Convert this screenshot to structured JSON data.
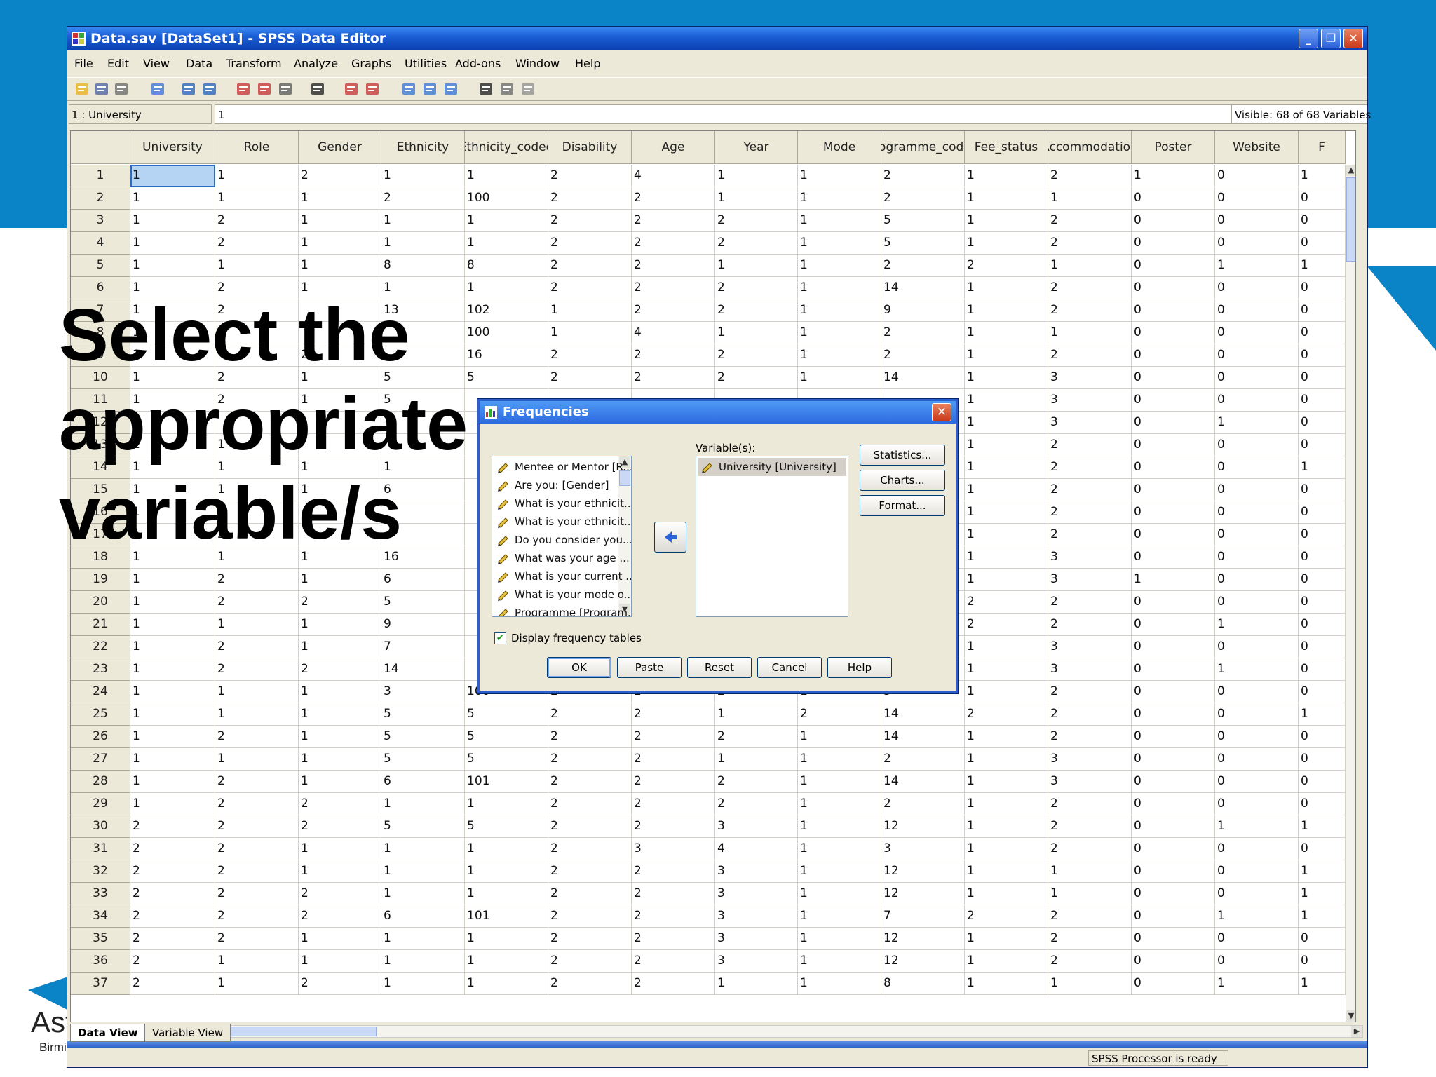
{
  "window": {
    "title": "Data.sav [DataSet1] - SPSS Data Editor"
  },
  "menu": [
    "File",
    "Edit",
    "View",
    "Data",
    "Transform",
    "Analyze",
    "Graphs",
    "Utilities",
    "Add-ons",
    "Window",
    "Help"
  ],
  "cellbar": {
    "ref": "1 : University",
    "value": "1",
    "visible": "Visible: 68 of 68 Variables"
  },
  "columns": [
    "University",
    "Role",
    "Gender",
    "Ethnicity",
    "Ethnicity_coded",
    "Disability",
    "Age",
    "Year",
    "Mode",
    "Programme_coded",
    "Fee_status",
    "Accommodation",
    "Poster",
    "Website",
    "F"
  ],
  "rows": [
    [
      "1",
      "1",
      "2",
      "1",
      "1",
      "2",
      "4",
      "1",
      "1",
      "2",
      "1",
      "2",
      "1",
      "0",
      "1"
    ],
    [
      "1",
      "1",
      "1",
      "2",
      "100",
      "2",
      "2",
      "1",
      "1",
      "2",
      "1",
      "1",
      "0",
      "0",
      "0"
    ],
    [
      "1",
      "2",
      "1",
      "1",
      "1",
      "2",
      "2",
      "2",
      "1",
      "5",
      "1",
      "2",
      "0",
      "0",
      "0"
    ],
    [
      "1",
      "2",
      "1",
      "1",
      "1",
      "2",
      "2",
      "2",
      "1",
      "5",
      "1",
      "2",
      "0",
      "0",
      "0"
    ],
    [
      "1",
      "1",
      "1",
      "8",
      "8",
      "2",
      "2",
      "1",
      "1",
      "2",
      "2",
      "1",
      "0",
      "1",
      "1"
    ],
    [
      "1",
      "2",
      "1",
      "1",
      "1",
      "2",
      "2",
      "2",
      "1",
      "14",
      "1",
      "2",
      "0",
      "0",
      "0"
    ],
    [
      "1",
      "2",
      "",
      "13",
      "102",
      "1",
      "2",
      "2",
      "1",
      "9",
      "1",
      "2",
      "0",
      "0",
      "0"
    ],
    [
      "1",
      "1",
      "",
      "",
      "100",
      "1",
      "4",
      "1",
      "1",
      "2",
      "1",
      "1",
      "0",
      "0",
      "0"
    ],
    [
      "1",
      "",
      "2",
      "",
      "16",
      "2",
      "2",
      "2",
      "1",
      "2",
      "1",
      "2",
      "0",
      "0",
      "0"
    ],
    [
      "1",
      "2",
      "1",
      "5",
      "5",
      "2",
      "2",
      "2",
      "1",
      "14",
      "1",
      "3",
      "0",
      "0",
      "0"
    ],
    [
      "1",
      "2",
      "1",
      "5",
      "",
      "",
      "",
      "",
      "",
      "",
      "1",
      "3",
      "0",
      "0",
      "0"
    ],
    [
      "1",
      "",
      "",
      "",
      "",
      "",
      "",
      "",
      "",
      "",
      "1",
      "3",
      "0",
      "1",
      "0"
    ],
    [
      "1",
      "1",
      "",
      "",
      "",
      "",
      "",
      "",
      "",
      "",
      "1",
      "2",
      "0",
      "0",
      "0"
    ],
    [
      "1",
      "1",
      "1",
      "1",
      "",
      "",
      "",
      "",
      "",
      "",
      "1",
      "2",
      "0",
      "0",
      "1"
    ],
    [
      "1",
      "1",
      "1",
      "6",
      "",
      "",
      "",
      "",
      "",
      "",
      "1",
      "2",
      "0",
      "0",
      "0"
    ],
    [
      "1",
      "2",
      "",
      "",
      "",
      "",
      "",
      "",
      "",
      "",
      "1",
      "2",
      "0",
      "0",
      "0"
    ],
    [
      "1",
      "2",
      "",
      "",
      "",
      "",
      "",
      "",
      "",
      "",
      "1",
      "2",
      "0",
      "0",
      "0"
    ],
    [
      "1",
      "1",
      "1",
      "16",
      "",
      "",
      "",
      "",
      "",
      "",
      "1",
      "3",
      "0",
      "0",
      "0"
    ],
    [
      "1",
      "2",
      "1",
      "6",
      "",
      "",
      "",
      "",
      "",
      "",
      "1",
      "3",
      "1",
      "0",
      "0"
    ],
    [
      "1",
      "2",
      "2",
      "5",
      "",
      "",
      "",
      "",
      "",
      "",
      "2",
      "2",
      "0",
      "0",
      "0"
    ],
    [
      "1",
      "1",
      "1",
      "9",
      "",
      "",
      "",
      "",
      "",
      "",
      "2",
      "2",
      "0",
      "1",
      "0"
    ],
    [
      "1",
      "2",
      "1",
      "7",
      "",
      "",
      "",
      "",
      "",
      "",
      "1",
      "3",
      "0",
      "0",
      "0"
    ],
    [
      "1",
      "2",
      "2",
      "14",
      "",
      "",
      "",
      "",
      "",
      "",
      "1",
      "3",
      "0",
      "1",
      "0"
    ],
    [
      "1",
      "1",
      "1",
      "3",
      "100",
      "2",
      "2",
      "2",
      "1",
      "5",
      "1",
      "2",
      "0",
      "0",
      "0"
    ],
    [
      "1",
      "1",
      "1",
      "5",
      "5",
      "2",
      "2",
      "1",
      "2",
      "14",
      "2",
      "2",
      "0",
      "0",
      "1"
    ],
    [
      "1",
      "2",
      "1",
      "5",
      "5",
      "2",
      "2",
      "2",
      "1",
      "14",
      "1",
      "2",
      "0",
      "0",
      "0"
    ],
    [
      "1",
      "1",
      "1",
      "5",
      "5",
      "2",
      "2",
      "1",
      "1",
      "2",
      "1",
      "3",
      "0",
      "0",
      "0"
    ],
    [
      "1",
      "2",
      "1",
      "6",
      "101",
      "2",
      "2",
      "2",
      "1",
      "14",
      "1",
      "3",
      "0",
      "0",
      "0"
    ],
    [
      "1",
      "2",
      "2",
      "1",
      "1",
      "2",
      "2",
      "2",
      "1",
      "2",
      "1",
      "2",
      "0",
      "0",
      "0"
    ],
    [
      "2",
      "2",
      "2",
      "5",
      "5",
      "2",
      "2",
      "3",
      "1",
      "12",
      "1",
      "2",
      "0",
      "1",
      "1"
    ],
    [
      "2",
      "2",
      "1",
      "1",
      "1",
      "2",
      "3",
      "4",
      "1",
      "3",
      "1",
      "2",
      "0",
      "0",
      "0"
    ],
    [
      "2",
      "2",
      "1",
      "1",
      "1",
      "2",
      "2",
      "3",
      "1",
      "12",
      "1",
      "1",
      "0",
      "0",
      "1"
    ],
    [
      "2",
      "2",
      "2",
      "1",
      "1",
      "2",
      "2",
      "3",
      "1",
      "12",
      "1",
      "1",
      "0",
      "0",
      "1"
    ],
    [
      "2",
      "2",
      "2",
      "6",
      "101",
      "2",
      "2",
      "3",
      "1",
      "7",
      "2",
      "2",
      "0",
      "1",
      "1"
    ],
    [
      "2",
      "2",
      "1",
      "1",
      "1",
      "2",
      "2",
      "3",
      "1",
      "12",
      "1",
      "2",
      "0",
      "0",
      "0"
    ],
    [
      "2",
      "1",
      "1",
      "1",
      "1",
      "2",
      "2",
      "3",
      "1",
      "12",
      "1",
      "2",
      "0",
      "0",
      "0"
    ],
    [
      "2",
      "1",
      "2",
      "1",
      "1",
      "2",
      "2",
      "1",
      "1",
      "8",
      "1",
      "1",
      "0",
      "1",
      "1"
    ]
  ],
  "tabs": {
    "data_view": "Data View",
    "variable_view": "Variable View"
  },
  "status": "SPSS  Processor is ready",
  "overlay": "Select the\nappropriate\nvariable/s",
  "logo": {
    "t1": "Ast",
    "t2": "Birmi"
  },
  "dialog": {
    "title": "Frequencies",
    "source_items": [
      "Mentee or Mentor [R...",
      "Are you: [Gender]",
      "What is your ethnicit...",
      "What is your ethnicit...",
      "Do you consider you...",
      "What was your age ...",
      "What is your current ...",
      "What is your mode o...",
      "Programme [Program..."
    ],
    "variables_label": "Variable(s):",
    "variables": [
      "University [University]"
    ],
    "side_buttons": [
      "Statistics...",
      "Charts...",
      "Format..."
    ],
    "checkbox_label": "Display frequency tables",
    "bottom_buttons": [
      "OK",
      "Paste",
      "Reset",
      "Cancel",
      "Help"
    ]
  },
  "colors": {
    "titlebar": "#1c5fd6",
    "slide_blue": "#0a84c6",
    "selection": "#b5d3f2"
  }
}
